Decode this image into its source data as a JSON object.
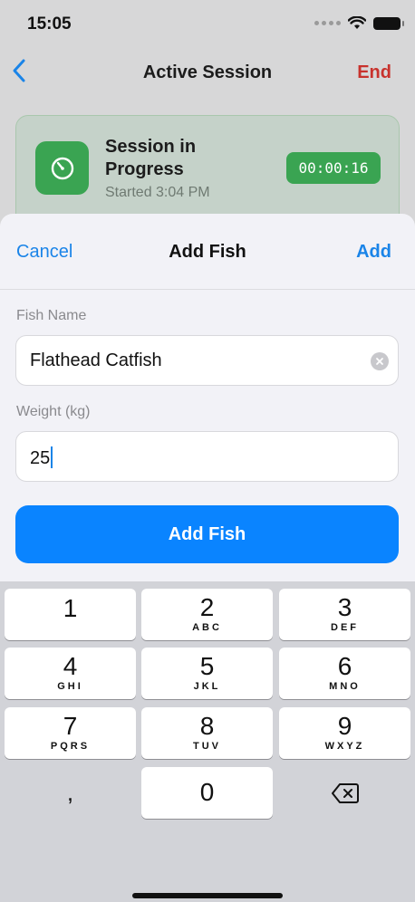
{
  "status_bar": {
    "time": "15:05"
  },
  "nav": {
    "title": "Active Session",
    "end_label": "End"
  },
  "session": {
    "title": "Session in Progress",
    "subtitle": "Started 3:04 PM",
    "timer": "00:00:16",
    "accent": "#3aa452"
  },
  "sheet": {
    "cancel_label": "Cancel",
    "title": "Add Fish",
    "add_label": "Add",
    "fish_name_label": "Fish Name",
    "fish_name_value": "Flathead Catfish",
    "weight_label": "Weight (kg)",
    "weight_value": "25",
    "submit_label": "Add Fish",
    "accent": "#0a84ff"
  },
  "keypad": {
    "keys": [
      {
        "digit": "1",
        "letters": ""
      },
      {
        "digit": "2",
        "letters": "ABC"
      },
      {
        "digit": "3",
        "letters": "DEF"
      },
      {
        "digit": "4",
        "letters": "GHI"
      },
      {
        "digit": "5",
        "letters": "JKL"
      },
      {
        "digit": "6",
        "letters": "MNO"
      },
      {
        "digit": "7",
        "letters": "PQRS"
      },
      {
        "digit": "8",
        "letters": "TUV"
      },
      {
        "digit": "9",
        "letters": "WXYZ"
      },
      {
        "digit": "0",
        "letters": ""
      }
    ],
    "comma": ",",
    "backspace_icon": "delete-left-icon"
  }
}
